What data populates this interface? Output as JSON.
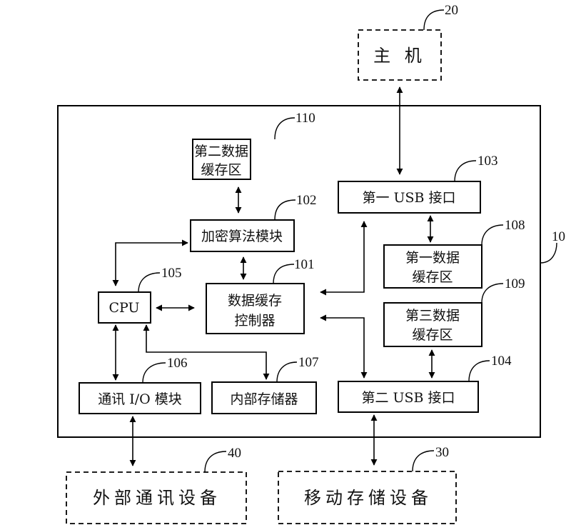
{
  "diagram": {
    "device": {
      "ref": "10"
    },
    "nodes": {
      "host": {
        "ref": "20",
        "lines": [
          "主 机"
        ]
      },
      "ext_comm": {
        "ref": "40",
        "lines": [
          "外部通讯设备"
        ]
      },
      "mobile": {
        "ref": "30",
        "lines": [
          "移动存储设备"
        ]
      },
      "buf2": {
        "ref": "110",
        "lines": [
          "第二数据",
          "缓存区"
        ]
      },
      "crypto": {
        "ref": "102",
        "lines": [
          "加密算法模块"
        ]
      },
      "ctrl": {
        "ref": "101",
        "lines": [
          "数据缓存",
          "控制器"
        ]
      },
      "cpu": {
        "ref": "105",
        "lines": [
          "CPU"
        ]
      },
      "io": {
        "ref": "106",
        "lines": [
          "通讯 I/O 模块"
        ]
      },
      "mem": {
        "ref": "107",
        "lines": [
          "内部存储器"
        ]
      },
      "usb1": {
        "ref": "103",
        "lines": [
          "第一 USB 接口"
        ]
      },
      "buf1": {
        "ref": "108",
        "lines": [
          "第一数据",
          "缓存区"
        ]
      },
      "buf3": {
        "ref": "109",
        "lines": [
          "第三数据",
          "缓存区"
        ]
      },
      "usb2": {
        "ref": "104",
        "lines": [
          "第二 USB 接口"
        ]
      }
    },
    "connections": [
      {
        "from": "host",
        "to": "usb1",
        "type": "bidirectional"
      },
      {
        "from": "buf2",
        "to": "crypto",
        "type": "bidirectional"
      },
      {
        "from": "crypto",
        "to": "ctrl",
        "type": "bidirectional"
      },
      {
        "from": "crypto",
        "to": "cpu",
        "type": "bidirectional"
      },
      {
        "from": "cpu",
        "to": "ctrl",
        "type": "bidirectional"
      },
      {
        "from": "cpu",
        "to": "io",
        "type": "bidirectional"
      },
      {
        "from": "cpu",
        "to": "mem",
        "type": "bidirectional"
      },
      {
        "from": "usb1",
        "to": "ctrl",
        "type": "bidirectional"
      },
      {
        "from": "usb1",
        "to": "buf1",
        "type": "bidirectional"
      },
      {
        "from": "usb2",
        "to": "ctrl",
        "type": "bidirectional"
      },
      {
        "from": "buf3",
        "to": "usb2",
        "type": "bidirectional"
      },
      {
        "from": "io",
        "to": "ext_comm",
        "type": "bidirectional"
      },
      {
        "from": "usb2",
        "to": "mobile",
        "type": "bidirectional"
      }
    ]
  }
}
